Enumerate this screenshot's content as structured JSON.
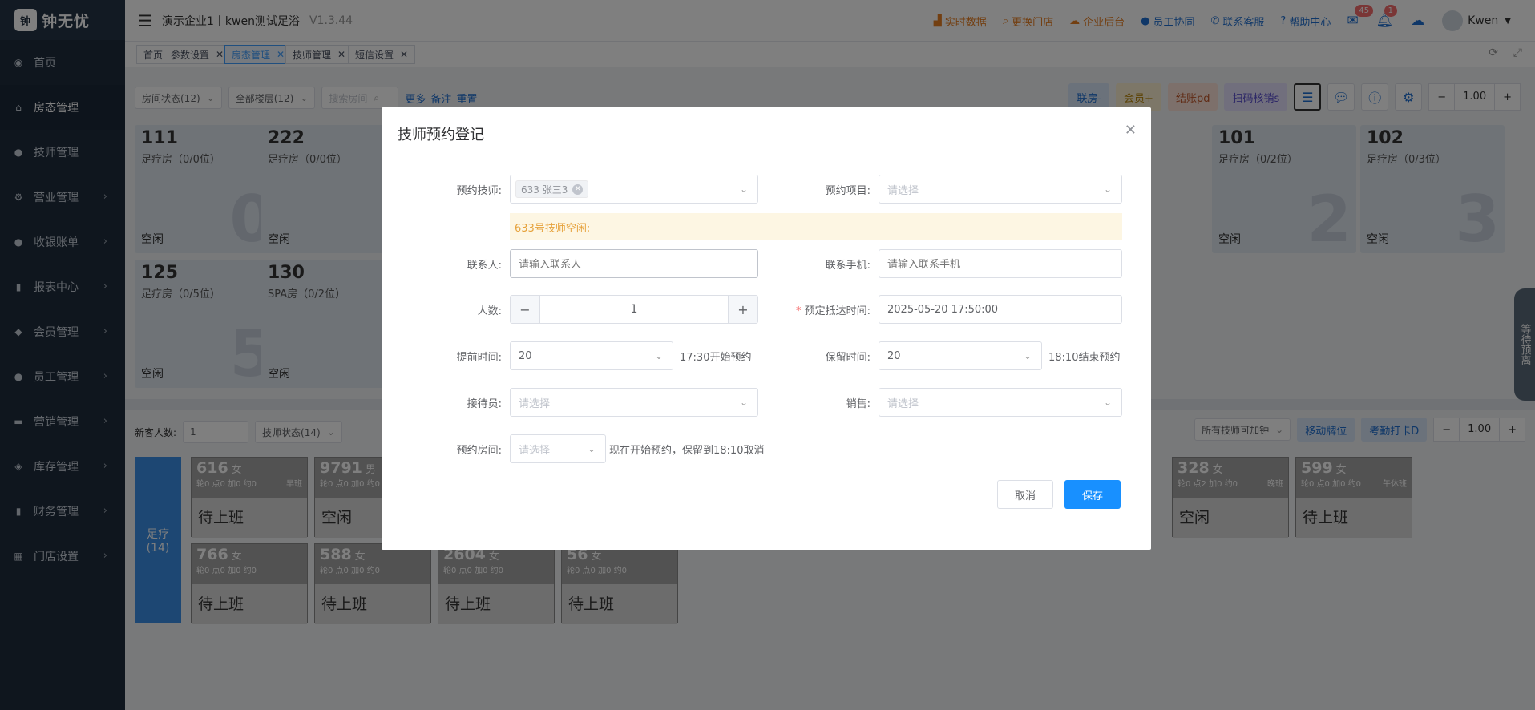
{
  "app": {
    "logo_text": "钟无忧",
    "logo_badge": "钟",
    "company": "演示企业1丨kwen测试足浴",
    "version": "V1.3.44"
  },
  "sidebar": {
    "items": [
      {
        "label": "首页",
        "icon": "dashboard-icon",
        "glyph": "◉",
        "arrow": ""
      },
      {
        "label": "房态管理",
        "icon": "home-icon",
        "glyph": "⌂",
        "arrow": ""
      },
      {
        "label": "技师管理",
        "icon": "user-icon",
        "glyph": "●",
        "arrow": ""
      },
      {
        "label": "营业管理",
        "icon": "settings-icon",
        "glyph": "⚙",
        "arrow": "›"
      },
      {
        "label": "收银账单",
        "icon": "money-icon",
        "glyph": "●",
        "arrow": "›"
      },
      {
        "label": "报表中心",
        "icon": "chart-icon",
        "glyph": "▮",
        "arrow": "›"
      },
      {
        "label": "会员管理",
        "icon": "diamond-icon",
        "glyph": "◆",
        "arrow": "›"
      },
      {
        "label": "员工管理",
        "icon": "person-icon",
        "glyph": "●",
        "arrow": "›"
      },
      {
        "label": "营销管理",
        "icon": "briefcase-icon",
        "glyph": "▬",
        "arrow": "›"
      },
      {
        "label": "库存管理",
        "icon": "box-icon",
        "glyph": "◈",
        "arrow": "›"
      },
      {
        "label": "财务管理",
        "icon": "finance-icon",
        "glyph": "▮",
        "arrow": "›"
      },
      {
        "label": "门店设置",
        "icon": "grid-icon",
        "glyph": "▦",
        "arrow": "›"
      }
    ]
  },
  "topbar": {
    "links": [
      {
        "label": "实时数据",
        "icon": "chart-icon",
        "glyph": "▟"
      },
      {
        "label": "更换门店",
        "icon": "search-icon",
        "glyph": "⌕"
      },
      {
        "label": "企业后台",
        "icon": "cloud-icon",
        "glyph": "☁"
      }
    ],
    "links_blue": [
      {
        "label": "员工协同",
        "icon": "users-icon",
        "glyph": "●"
      },
      {
        "label": "联系客服",
        "icon": "phone-icon",
        "glyph": "✆"
      },
      {
        "label": "帮助中心",
        "icon": "help-icon",
        "glyph": "?"
      }
    ],
    "mail_badge": "45",
    "bell_badge": "1",
    "user": "Kwen"
  },
  "tabs": [
    {
      "label": "首页",
      "closable": false
    },
    {
      "label": "参数设置",
      "closable": true
    },
    {
      "label": "房态管理",
      "closable": true,
      "active": true
    },
    {
      "label": "技师管理",
      "closable": true
    },
    {
      "label": "短信设置",
      "closable": true
    }
  ],
  "toolbar1": {
    "room_status": "房间状态(12)",
    "floor": "全部楼层(12)",
    "search_placeholder": "搜索房间",
    "more": "更多",
    "note": "备注",
    "reset": "重置",
    "btns": [
      {
        "label": "联房-",
        "bg": "#d6e4f7",
        "color": "#1f6fd1"
      },
      {
        "label": "会员+",
        "bg": "#fbeed0",
        "color": "#b8860b"
      },
      {
        "label": "结账pd",
        "bg": "#fbe1d6",
        "color": "#c0562a"
      },
      {
        "label": "扫码核销s",
        "bg": "#e2defa",
        "color": "#5a4fcf"
      }
    ],
    "zoom": "1.00"
  },
  "rooms": [
    {
      "num": "111",
      "type": "足疗房（0/0位）",
      "status": "空闲",
      "big": "0"
    },
    {
      "num": "222",
      "type": "足疗房（0/0位）",
      "status": "空闲",
      "big": ""
    },
    {
      "num": "101",
      "type": "足疗房（0/2位）",
      "status": "空闲",
      "big": "2"
    },
    {
      "num": "102",
      "type": "足疗房（0/3位）",
      "status": "空闲",
      "big": "3"
    },
    {
      "num": "125",
      "type": "足疗房（0/5位）",
      "status": "空闲",
      "big": "5"
    },
    {
      "num": "130",
      "type": "SPA房（0/2位）",
      "status": "空闲",
      "big": ""
    }
  ],
  "toolbar2": {
    "new_guests_label": "新客人数:",
    "new_guests_value": "1",
    "tech_status": "技师状态(14)",
    "all_clock": "所有技师可加钟",
    "move": "移动牌位",
    "attendance": "考勤打卡D",
    "zoom": "1.00"
  },
  "group": {
    "label": "足疗",
    "count": "(14)"
  },
  "techs": [
    {
      "n": "616",
      "g": "女",
      "sub": "轮0 点0 加0 约0",
      "shift": "早班",
      "st": "待上班"
    },
    {
      "n": "9791",
      "g": "男",
      "sub": "轮0 点0 加0 约0",
      "shift": "",
      "st": "空闲"
    },
    {
      "n": "328",
      "g": "女",
      "sub": "轮0 点2 加0 约0",
      "shift": "晚班",
      "st": "空闲"
    },
    {
      "n": "599",
      "g": "女",
      "sub": "轮0 点0 加0 约0",
      "shift": "午休班",
      "st": "待上班"
    },
    {
      "n": "766",
      "g": "女",
      "sub": "轮0 点0 加0 约0",
      "shift": "",
      "st": "待上班"
    },
    {
      "n": "588",
      "g": "女",
      "sub": "轮0 点0 加0 约0",
      "shift": "",
      "st": "待上班"
    },
    {
      "n": "2604",
      "g": "女",
      "sub": "轮0 点0 加0 约0",
      "shift": "",
      "st": "待上班"
    },
    {
      "n": "56",
      "g": "女",
      "sub": "轮0 点0 加0 约0",
      "shift": "",
      "st": "待上班"
    }
  ],
  "side_handle": "等待预离",
  "dialog": {
    "title": "技师预约登记",
    "tech_label": "预约技师:",
    "tech_tag": "633 张三3",
    "project_label": "预约项目:",
    "project_placeholder": "请选择",
    "warning": "633号技师空闲;",
    "contact_label": "联系人:",
    "contact_placeholder": "请输入联系人",
    "phone_label": "联系手机:",
    "phone_placeholder": "请输入联系手机",
    "people_label": "人数:",
    "people_value": "1",
    "arrival_label": "预定抵达时间:",
    "arrival_value": "2025-05-20 17:50:00",
    "advance_label": "提前时间:",
    "advance_value": "20",
    "advance_hint": "17:30开始预约",
    "keep_label": "保留时间:",
    "keep_value": "20",
    "keep_hint": "18:10结束预约",
    "receptionist_label": "接待员:",
    "receptionist_placeholder": "请选择",
    "sales_label": "销售:",
    "sales_placeholder": "请选择",
    "room_label": "预约房间:",
    "room_placeholder": "请选择",
    "room_hint": "现在开始预约，保留到18:10取消",
    "cancel": "取消",
    "save": "保存"
  }
}
